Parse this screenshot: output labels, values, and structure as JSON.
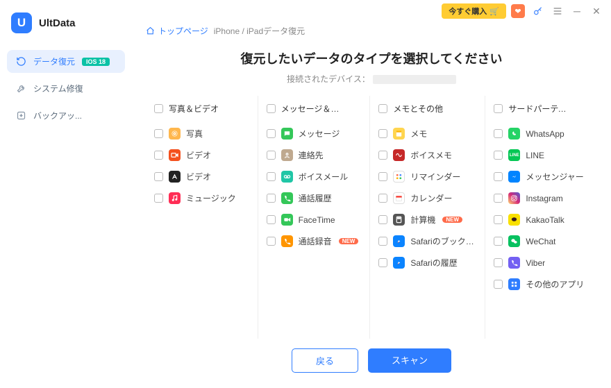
{
  "titlebar": {
    "buy_label": "今すぐ購入"
  },
  "brand": {
    "logo_char": "U",
    "name": "UltData"
  },
  "sidebar": {
    "items": [
      {
        "label": "データ復元",
        "badge": "IOS 18"
      },
      {
        "label": "システム修復"
      },
      {
        "label": "バックアッ..."
      }
    ]
  },
  "breadcrumb": {
    "home": "トップページ",
    "page": "iPhone / iPadデータ復元"
  },
  "headline": "復元したいデータのタイプを選択してください",
  "subhead": "接続されたデバイス：",
  "columns": [
    {
      "header": "写真＆ビデオ",
      "items": [
        {
          "label": "写真",
          "ic": "photo",
          "bg": "#ffb74d"
        },
        {
          "label": "ビデオ",
          "ic": "video",
          "bg": "#f4511e"
        },
        {
          "label": "ビデオ",
          "ic": "atv",
          "bg": "#222"
        },
        {
          "label": "ミュージック",
          "ic": "music",
          "bg": "#ff2d55"
        }
      ]
    },
    {
      "header": "メッセージ＆通話...",
      "items": [
        {
          "label": "メッセージ",
          "ic": "msg",
          "bg": "#34c759"
        },
        {
          "label": "連絡先",
          "ic": "contact",
          "bg": "#bfa98f"
        },
        {
          "label": "ボイスメール",
          "ic": "vm",
          "bg": "#20c6a6"
        },
        {
          "label": "通話履歴",
          "ic": "phone",
          "bg": "#34c759"
        },
        {
          "label": "FaceTime",
          "ic": "ft",
          "bg": "#34c759"
        },
        {
          "label": "通話録音",
          "ic": "rec",
          "bg": "#ff9500",
          "new": true
        }
      ]
    },
    {
      "header": "メモとその他",
      "items": [
        {
          "label": "メモ",
          "ic": "note",
          "bg": "#ffd54f"
        },
        {
          "label": "ボイスメモ",
          "ic": "vmemo",
          "bg": "#c62828"
        },
        {
          "label": "リマインダー",
          "ic": "rem",
          "bg": "#fff",
          "border": "#ddd"
        },
        {
          "label": "カレンダー",
          "ic": "cal",
          "bg": "#fff",
          "border": "#ddd"
        },
        {
          "label": "計算機",
          "ic": "calc",
          "bg": "#555",
          "new": true
        },
        {
          "label": "Safariのブックマ...",
          "ic": "safari",
          "bg": "#0b84ff"
        },
        {
          "label": "Safariの履歴",
          "ic": "safari",
          "bg": "#0b84ff"
        }
      ]
    },
    {
      "header": "サードパーティ製...",
      "items": [
        {
          "label": "WhatsApp",
          "ic": "wa",
          "bg": "#25d366"
        },
        {
          "label": "LINE",
          "ic": "line",
          "bg": "#06c755"
        },
        {
          "label": "メッセンジャー",
          "ic": "mess",
          "bg": "#0084ff"
        },
        {
          "label": "Instagram",
          "ic": "ig",
          "bg": "linear-gradient(45deg,#feda75,#d62976,#4f5bd5)"
        },
        {
          "label": "KakaoTalk",
          "ic": "kakao",
          "bg": "#f9e000"
        },
        {
          "label": "WeChat",
          "ic": "wechat",
          "bg": "#07c160"
        },
        {
          "label": "Viber",
          "ic": "viber",
          "bg": "#7360f2"
        },
        {
          "label": "その他のアプリ",
          "ic": "grid",
          "bg": "#2f7dff"
        }
      ]
    }
  ],
  "footer": {
    "back": "戻る",
    "scan": "スキャン"
  },
  "new_label": "NEW"
}
